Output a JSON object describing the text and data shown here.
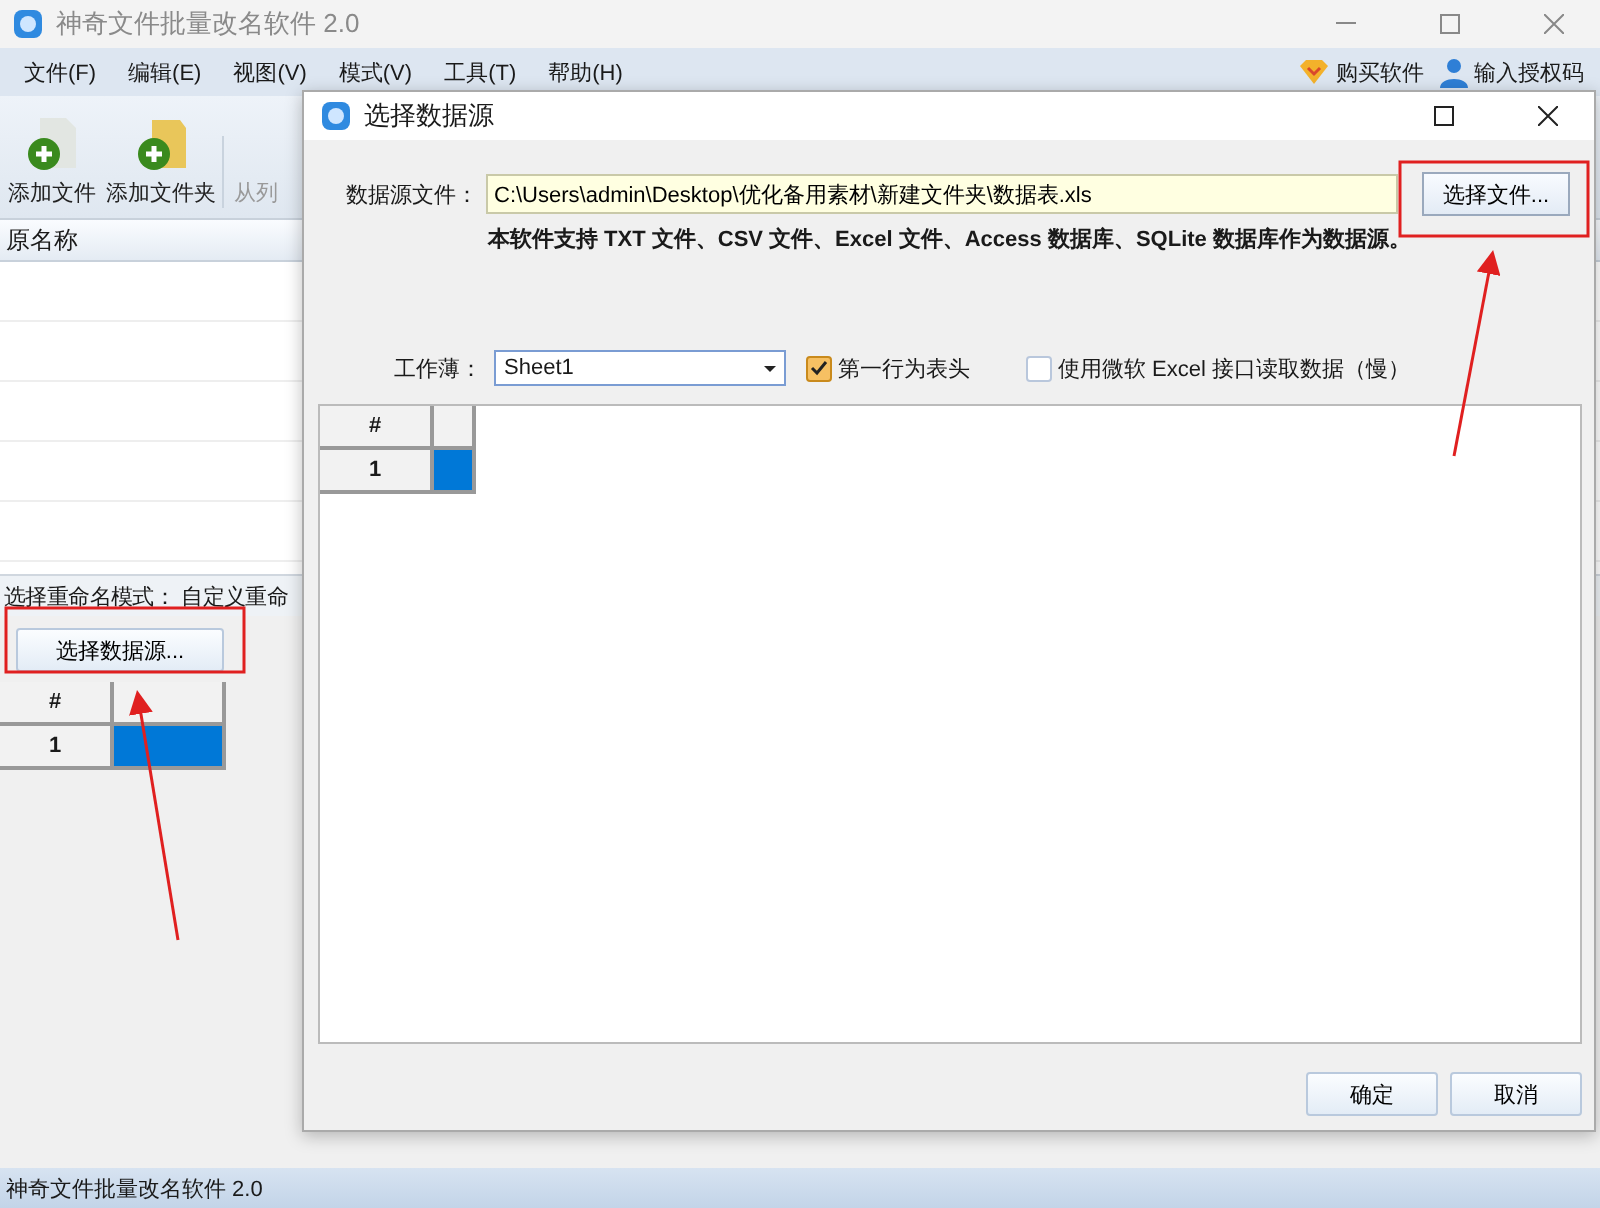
{
  "main_window": {
    "title": "神奇文件批量改名软件 2.0",
    "menu": [
      "文件(F)",
      "编辑(E)",
      "视图(V)",
      "模式(V)",
      "工具(T)",
      "帮助(H)"
    ],
    "links": [
      {
        "kind": "buy",
        "label": "购买软件"
      },
      {
        "kind": "license",
        "label": "输入授权码"
      }
    ],
    "toolbar": [
      {
        "kind": "file",
        "label": "添加文件"
      },
      {
        "kind": "folder",
        "label": "添加文件夹"
      },
      {
        "kind": "text",
        "label": "从列"
      }
    ],
    "list": {
      "columns": [
        "原名称"
      ]
    },
    "mode_label": "选择重命名模式：",
    "mode_value": "自定义重命",
    "data_source_button": "选择数据源...",
    "table": {
      "columns": [
        "#"
      ],
      "rows": [
        {
          "number": "1",
          "selected": true
        }
      ]
    },
    "status_bar": "神奇文件批量改名软件 2.0"
  },
  "dialog": {
    "title": "选择数据源",
    "source_label": "数据源文件：",
    "source_path": "C:\\Users\\admin\\Desktop\\优化备用素材\\新建文件夹\\数据表.xls",
    "browse_button": "选择文件...",
    "note": "本软件支持 TXT 文件、CSV 文件、Excel 文件、Access 数据库、SQLite 数据库作为数据源。",
    "workbook_label": "工作薄：",
    "workbook": "Sheet1",
    "options": [
      {
        "label": "第一行为表头",
        "checked": true
      },
      {
        "label": "使用微软 Excel 接口读取数据（慢）",
        "checked": false
      }
    ],
    "grid": {
      "columns": [
        "#"
      ],
      "rows": [
        {
          "number": "1",
          "selected": true
        }
      ]
    },
    "buttons": [
      "确定",
      "取消"
    ]
  }
}
